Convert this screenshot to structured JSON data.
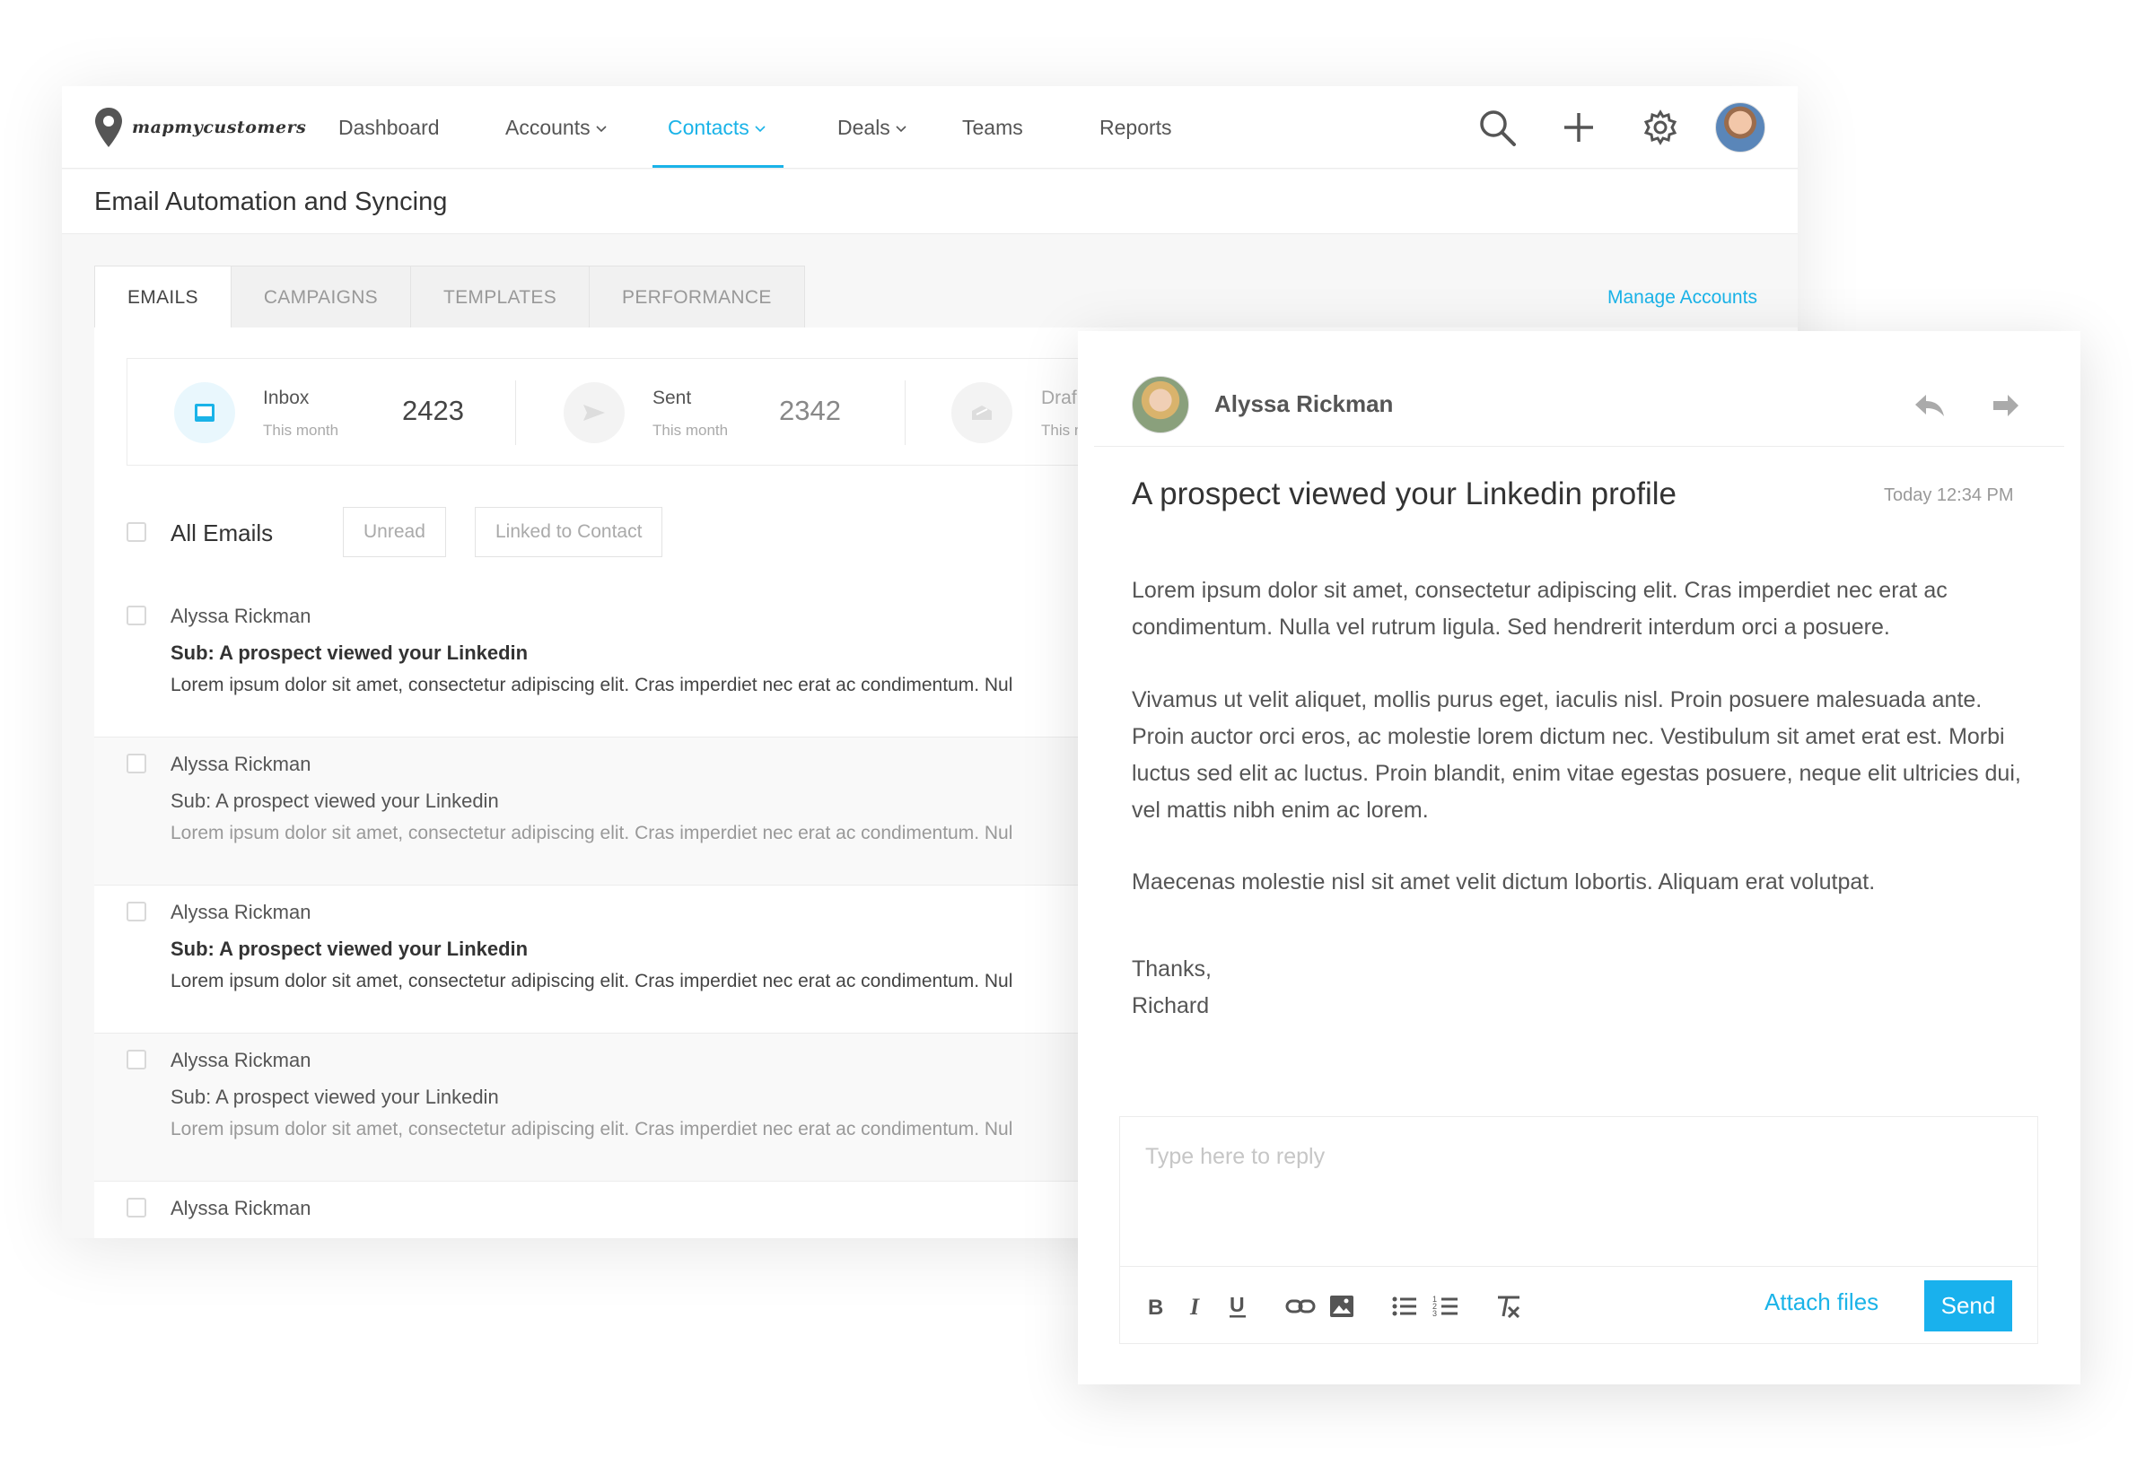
{
  "brand": {
    "name": "mapmycustomers",
    "accent": "#1ab3e8"
  },
  "nav": {
    "items": [
      {
        "label": "Dashboard",
        "dropdown": false,
        "active": false
      },
      {
        "label": "Accounts",
        "dropdown": true,
        "active": false
      },
      {
        "label": "Contacts",
        "dropdown": true,
        "active": true
      },
      {
        "label": "Deals",
        "dropdown": true,
        "active": false
      },
      {
        "label": "Teams",
        "dropdown": false,
        "active": false
      },
      {
        "label": "Reports",
        "dropdown": false,
        "active": false
      }
    ],
    "icons": [
      "search-icon",
      "plus-icon",
      "gear-icon",
      "user-avatar"
    ]
  },
  "page": {
    "title": "Email Automation and Syncing"
  },
  "tabs": [
    "EMAILS",
    "CAMPAIGNS",
    "TEMPLATES",
    "PERFORMANCE"
  ],
  "active_tab": "EMAILS",
  "manage_accounts": "Manage Accounts",
  "stats": [
    {
      "label": "Inbox",
      "sub": "This month",
      "value": "2423",
      "icon": "inbox-icon"
    },
    {
      "label": "Sent",
      "sub": "This month",
      "value": "2342",
      "icon": "send-icon"
    },
    {
      "label": "Draf",
      "sub": "This m",
      "value": "",
      "icon": "draft-icon"
    }
  ],
  "filters": {
    "all_label": "All Emails",
    "buttons": [
      "Unread",
      "Linked to Contact"
    ]
  },
  "emails": [
    {
      "name": "Alyssa Rickman",
      "subject": "Sub: A prospect viewed your Linkedin",
      "preview": "Lorem ipsum dolor sit amet, consectetur adipiscing elit. Cras imperdiet nec erat ac condimentum. Nul",
      "unread": true
    },
    {
      "name": "Alyssa Rickman",
      "subject": "Sub: A prospect viewed your Linkedin",
      "preview": "Lorem ipsum dolor sit amet, consectetur adipiscing elit. Cras imperdiet nec erat ac condimentum. Nul",
      "unread": false
    },
    {
      "name": "Alyssa Rickman",
      "subject": "Sub: A prospect viewed your Linkedin",
      "preview": "Lorem ipsum dolor sit amet, consectetur adipiscing elit. Cras imperdiet nec erat ac condimentum. Nul",
      "unread": true
    },
    {
      "name": "Alyssa Rickman",
      "subject": "Sub: A prospect viewed your Linkedin",
      "preview": "Lorem ipsum dolor sit amet, consectetur adipiscing elit. Cras imperdiet nec erat ac condimentum. Nul",
      "unread": false
    },
    {
      "name": "Alyssa Rickman",
      "subject": "",
      "preview": "",
      "unread": false
    }
  ],
  "reader": {
    "sender": "Alyssa Rickman",
    "subject": "A prospect viewed your Linkedin profile",
    "time": "Today 12:34 PM",
    "paragraphs": [
      "Lorem ipsum dolor sit amet, consectetur adipiscing elit. Cras imperdiet nec erat ac condimentum. Nulla vel rutrum ligula. Sed hendrerit interdum orci a posuere.",
      "Vivamus ut velit aliquet, mollis purus eget, iaculis nisl. Proin posuere malesuada ante. Proin auctor orci eros, ac molestie lorem dictum nec. Vestibulum sit amet erat est. Morbi luctus sed elit ac luctus. Proin blandit, enim vitae egestas posuere, neque elit ultricies dui, vel mattis nibh enim ac lorem.",
      "Maecenas molestie nisl sit amet velit dictum lobortis. Aliquam erat volutpat."
    ],
    "signoff": "Thanks,",
    "signature": "Richard",
    "reply_placeholder": "Type here to reply",
    "attach_label": "Attach files",
    "send_label": "Send"
  }
}
